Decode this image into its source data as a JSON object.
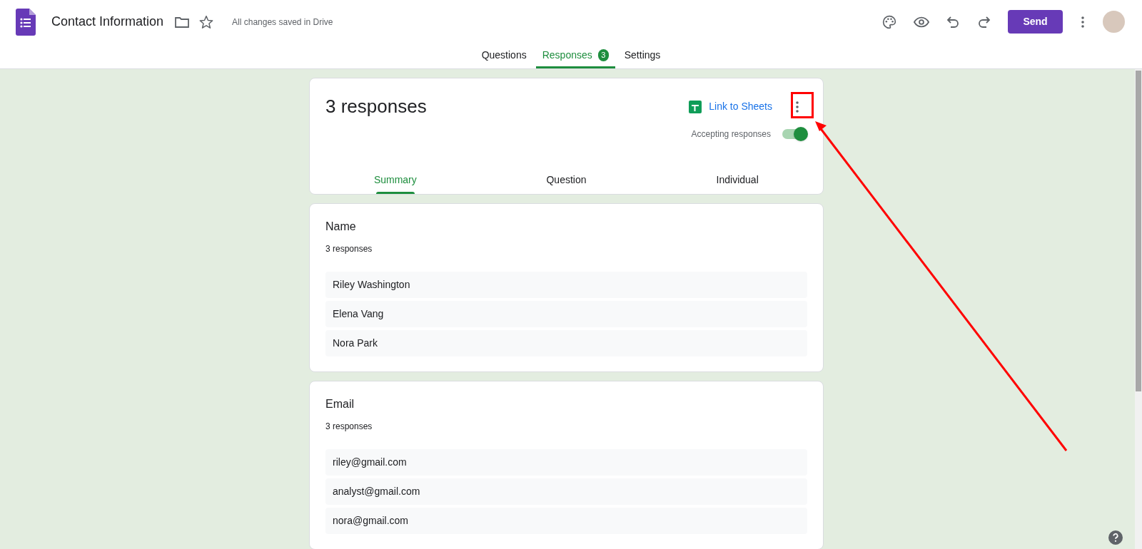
{
  "header": {
    "title": "Contact Information",
    "save_status": "All changes saved in Drive",
    "send_button": "Send"
  },
  "tabs": [
    {
      "label": "Questions",
      "selected": false
    },
    {
      "label": "Responses",
      "selected": true,
      "badge": "3"
    },
    {
      "label": "Settings",
      "selected": false
    }
  ],
  "responses_card": {
    "title": "3 responses",
    "link_to_sheets": "Link to Sheets",
    "accepting_label": "Accepting responses",
    "accepting_on": true,
    "view_tabs": [
      {
        "label": "Summary",
        "selected": true
      },
      {
        "label": "Question",
        "selected": false
      },
      {
        "label": "Individual",
        "selected": false
      }
    ]
  },
  "questions": [
    {
      "title": "Name",
      "count": "3 responses",
      "answers": [
        "Riley Washington",
        "Elena Vang",
        "Nora Park"
      ]
    },
    {
      "title": "Email",
      "count": "3 responses",
      "answers": [
        "riley@gmail.com",
        "analyst@gmail.com",
        "nora@gmail.com"
      ]
    }
  ]
}
